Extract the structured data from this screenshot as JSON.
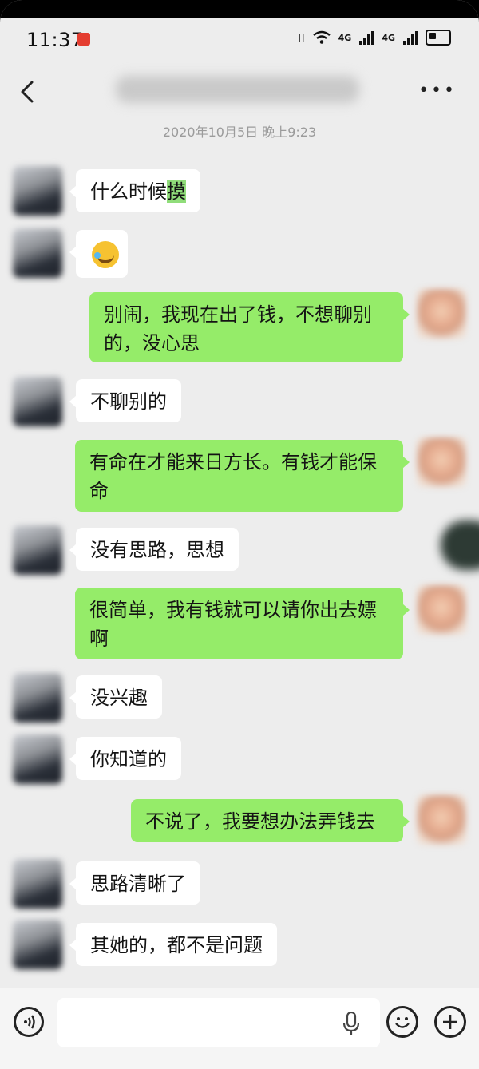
{
  "status_bar": {
    "time": "11:37",
    "net1": "4G",
    "net2": "4G"
  },
  "header": {
    "back_icon": "chevron-left-icon",
    "title": "",
    "more_icon": "more-dots-icon"
  },
  "timestamp": "2020年10月5日 晚上9:23",
  "messages": [
    {
      "side": "in",
      "text_before": "什么时候",
      "highlight": "摸"
    },
    {
      "side": "in",
      "emoji": "crying-laughing-emoji"
    },
    {
      "side": "out",
      "text": "别闹，我现在出了钱，不想聊别的，没心思"
    },
    {
      "side": "in",
      "text": "不聊别的"
    },
    {
      "side": "out",
      "text": "有命在才能来日方长。有钱才能保命"
    },
    {
      "side": "in",
      "text": "没有思路，思想"
    },
    {
      "side": "out",
      "text": "很简单，我有钱就可以请你出去嫖啊"
    },
    {
      "side": "in",
      "text": "没兴趣"
    },
    {
      "side": "in",
      "text": "你知道的"
    },
    {
      "side": "out",
      "text": "不说了，我要想办法弄钱去"
    },
    {
      "side": "in",
      "text": "思路清晰了"
    },
    {
      "side": "in",
      "text": "其她的，都不是问题"
    }
  ],
  "colors": {
    "out_bubble": "#95ec69",
    "in_bubble": "#ffffff",
    "background": "#ededed"
  },
  "input_bar": {
    "value": "",
    "voice_icon": "voice-icon",
    "mic_icon": "mic-icon",
    "emoji_icon": "emoji-icon",
    "plus_icon": "plus-icon"
  }
}
